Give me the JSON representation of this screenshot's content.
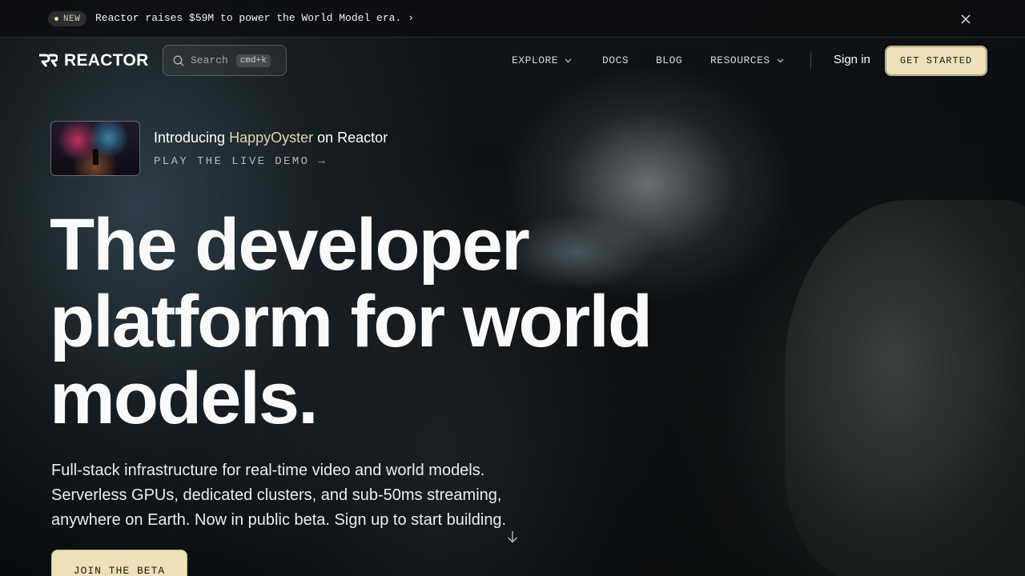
{
  "announcement": {
    "badge": "NEW",
    "text": "Reactor raises $59M to power the World Model era.",
    "arrow": "›",
    "close_icon": "close-icon"
  },
  "nav": {
    "logo_text": "REACTOR",
    "search_placeholder": "Search",
    "search_shortcut": "cmd+k",
    "items": [
      {
        "label": "EXPLORE",
        "has_dropdown": true
      },
      {
        "label": "DOCS",
        "has_dropdown": false
      },
      {
        "label": "BLOG",
        "has_dropdown": false
      },
      {
        "label": "RESOURCES",
        "has_dropdown": true
      }
    ],
    "signin_label": "Sign in",
    "cta_label": "GET STARTED"
  },
  "promo": {
    "title_prefix": "Introducing",
    "title_accent": "HappyOyster",
    "title_suffix": "on Reactor",
    "link_label": "PLAY THE LIVE DEMO →"
  },
  "hero": {
    "headline": "The developer platform for world models.",
    "subtext": "Full-stack infrastructure for real-time video and world models. Serverless GPUs, dedicated clusters, and sub-50ms streaming, anywhere on Earth. Now in public beta. Sign up to start building.",
    "join_label": "JOIN THE BETA"
  },
  "colors": {
    "accent": "#ece1b8",
    "accent_text": "#e3d7a6",
    "background": "#0b0d0f"
  }
}
